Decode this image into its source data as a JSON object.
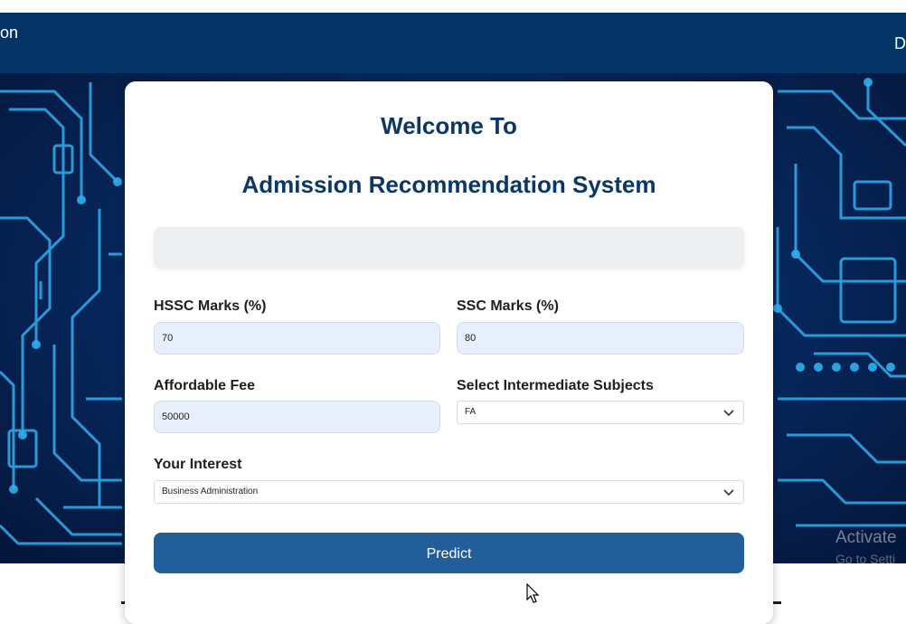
{
  "navbar": {
    "left_text": "on",
    "right_text": "D"
  },
  "card": {
    "title_line1": "Welcome To",
    "title_line2": "Admission Recommendation System"
  },
  "form": {
    "hssc": {
      "label": "HSSC Marks (%)",
      "value": "70"
    },
    "ssc": {
      "label": "SSC Marks (%)",
      "value": "80"
    },
    "fee": {
      "label": "Affordable Fee",
      "value": "50000"
    },
    "subjects": {
      "label": "Select Intermediate Subjects",
      "selected": "FA"
    },
    "interest": {
      "label": "Your Interest",
      "selected": "Business Administration"
    },
    "predict_label": "Predict"
  },
  "watermark": {
    "line1": "Activate",
    "line2": "Go to Setti"
  },
  "colors": {
    "navbar": "#043466",
    "heading": "#0b3768",
    "button": "#225e99",
    "input_bg": "#e8effc",
    "circuit": "#2fb0f0"
  },
  "icons": {
    "dropdown": "chevron-down-icon",
    "pointer": "mouse-cursor-icon"
  }
}
